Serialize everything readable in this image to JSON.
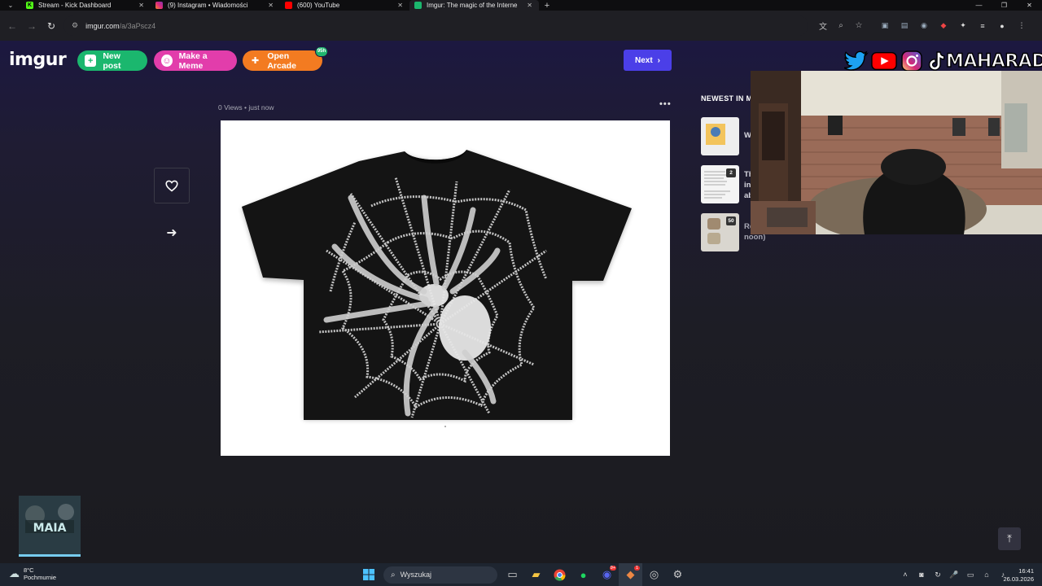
{
  "browser": {
    "tabs": [
      {
        "title": "Stream - Kick Dashboard",
        "color": "#53fc18",
        "active": false
      },
      {
        "title": "(9) Instagram • Wiadomości",
        "color": "#e1306c",
        "active": false
      },
      {
        "title": "(600) YouTube",
        "color": "#ff0000",
        "active": false
      },
      {
        "title": "Imgur: The magic of the Interne",
        "color": "#1bb76e",
        "active": true
      }
    ],
    "new_tab": "+",
    "url_host": "imgur.com",
    "url_path": "/a/3aPscz4"
  },
  "imgur": {
    "logo": "imgur",
    "new_post": "New post",
    "make_meme": "Make a Meme",
    "open_arcade": "Open Arcade",
    "arcade_badge": "95h",
    "next": "Next",
    "post_views": "0 Views",
    "post_time": "just now",
    "newest_heading": "NEWEST IN M",
    "newest_items": [
      {
        "label": "W",
        "count": ""
      },
      {
        "label": "Th\nin\nab",
        "count": "2"
      },
      {
        "label": "Re\nnoon)",
        "count": "50"
      }
    ]
  },
  "overlay": {
    "handle": "MAHARADZZA"
  },
  "taskbar": {
    "temperature": "8°C",
    "weather": "Pochmurnie",
    "search_placeholder": "Wyszukaj",
    "time": "16:41",
    "date": "26.03.2026",
    "discord_badge": "9+",
    "app_badge": "1"
  },
  "colors": {
    "accent_next": "#4b3fe8",
    "new_post": "#1bb76e",
    "make_meme": "#e23dab",
    "open_arcade": "#f37b21"
  }
}
